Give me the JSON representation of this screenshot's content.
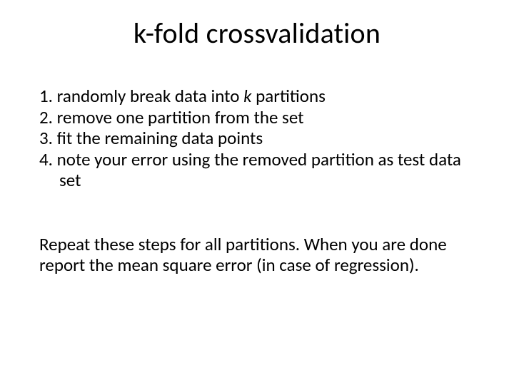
{
  "title": "k-fold crossvalidation",
  "steps": [
    {
      "num": "1.",
      "text_a": "randomly break data into  ",
      "k": "k",
      "text_b": " partitions"
    },
    {
      "num": "2.",
      "text_a": "remove one partition from the set",
      "k": "",
      "text_b": ""
    },
    {
      "num": "3.",
      "text_a": "fit the remaining data points",
      "k": "",
      "text_b": ""
    },
    {
      "num": "4.",
      "text_a": "note your error using the removed partition as test data set",
      "k": "",
      "text_b": ""
    }
  ],
  "footer": "Repeat these steps for all partitions. When you are done report the mean square error (in case of regression)."
}
